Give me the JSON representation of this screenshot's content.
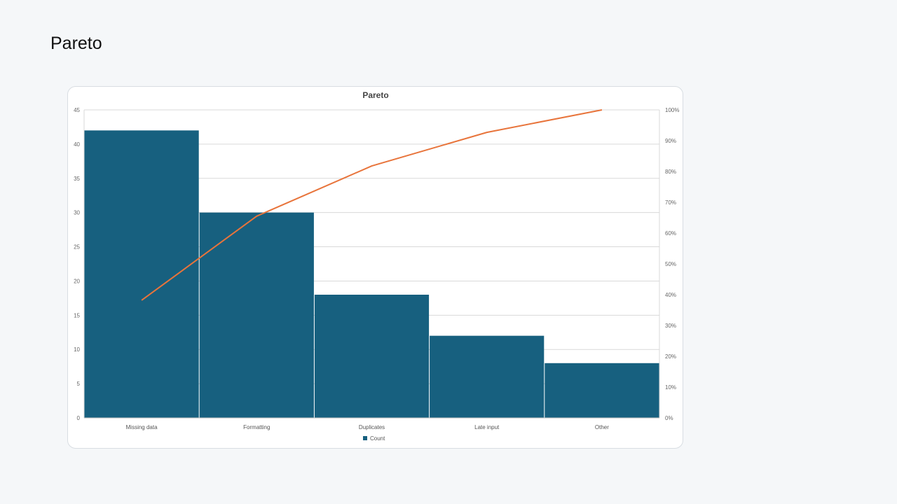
{
  "page": {
    "title": "Pareto"
  },
  "chart_data": {
    "type": "bar",
    "title": "Pareto",
    "categories": [
      "Missing data",
      "Formatting",
      "Duplicates",
      "Late input",
      "Other"
    ],
    "series": [
      {
        "name": "Count",
        "type": "bar",
        "values": [
          42,
          30,
          18,
          12,
          8
        ],
        "color": "#17607f"
      },
      {
        "type": "line",
        "axis": "right",
        "values": [
          0.382,
          0.655,
          0.818,
          0.927,
          1.0
        ],
        "color": "#e8743b"
      }
    ],
    "y_left": {
      "ylim": [
        0,
        45
      ],
      "ticks": [
        0,
        5,
        10,
        15,
        20,
        25,
        30,
        35,
        40,
        45
      ]
    },
    "y_right": {
      "ylim": [
        0,
        1
      ],
      "ticks": [
        "0%",
        "10%",
        "20%",
        "30%",
        "40%",
        "50%",
        "60%",
        "70%",
        "80%",
        "90%",
        "100%"
      ]
    },
    "grid": true,
    "legend": {
      "placement": "bottom",
      "entries": [
        "Count"
      ]
    }
  }
}
